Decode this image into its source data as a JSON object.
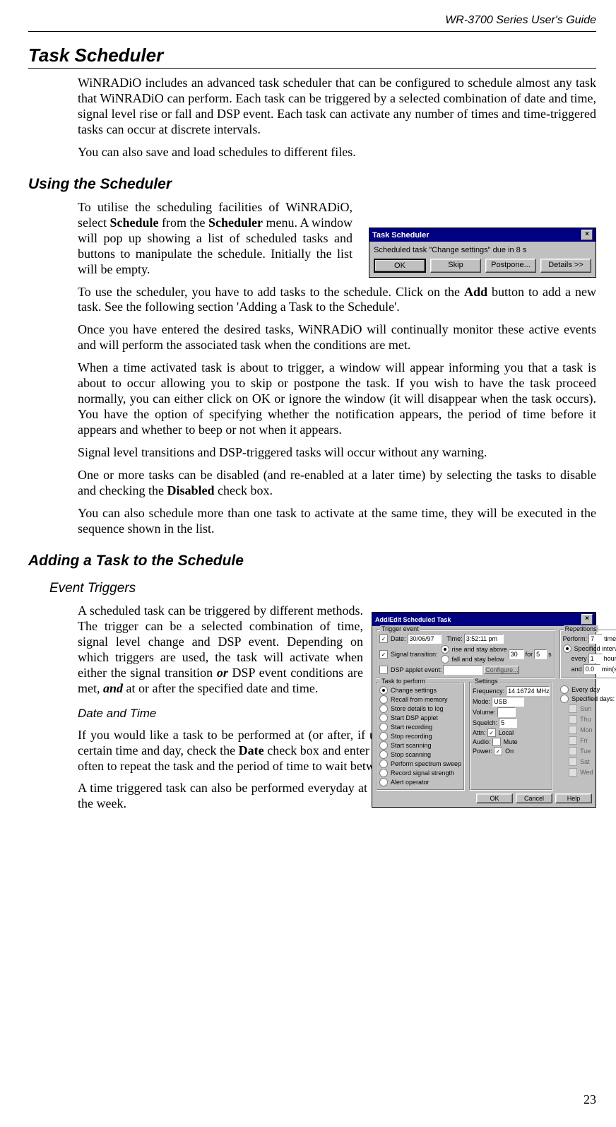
{
  "header": {
    "guide_title": "WR-3700 Series User's Guide"
  },
  "page_number": "23",
  "h1": "Task Scheduler",
  "p1": "WiNRADiO includes an advanced task scheduler that can be configured to schedule almost any task that WiNRADiO can perform. Each task can be triggered by a selected combination of date and time, signal level rise or fall and DSP event. Each task can activate any number of times and time-triggered tasks can occur at discrete intervals.",
  "p2": "You can also save and load schedules to different files.",
  "h2a": "Using the Scheduler",
  "p3_pre": "To utilise the scheduling facilities of WiNRADiO, select ",
  "p3_b1": "Schedule",
  "p3_mid": " from the ",
  "p3_b2": "Scheduler",
  "p3_post": " menu. A window will pop up showing a list of scheduled tasks and buttons to manipulate the schedule. Initially the list will be empty.",
  "p4_pre": "To use the scheduler, you have to add tasks to the schedule. Click on the ",
  "p4_b": "Add",
  "p4_post": " button to add a new task. See the following section 'Adding a Task to the Schedule'.",
  "p5": "Once you have entered the desired tasks, WiNRADiO will continually monitor these active events and will perform the associated task when the conditions are met.",
  "p6": "When a time activated task is about to trigger, a window will appear informing you that a task is about to occur allowing you to skip or postpone the task. If you wish to have the task proceed normally, you can either click on OK or ignore the window (it will disappear when the task occurs). You have the option of specifying whether the notification appears, the period of time before it appears and whether to beep or not when it appears.",
  "p7": "Signal level transitions and DSP-triggered tasks will occur without any warning.",
  "p8_pre": "One or more tasks can be disabled (and re-enabled at a later time) by selecting the tasks to disable and checking the ",
  "p8_b": "Disabled",
  "p8_post": " check box.",
  "p9": "You can also schedule more than one task to activate at the same time, they will be executed in the sequence shown in the list.",
  "h2b": "Adding a Task to the Schedule",
  "h3a": "Event Triggers",
  "p10_pre": "A scheduled task can be triggered by different methods. The trigger can be a selected combination of time, signal level change and DSP event. Depending on which triggers are used, the task will activate when either the signal transition ",
  "p10_i1": "or",
  "p10_mid": " DSP event conditions are met, ",
  "p10_i2": "and",
  "p10_post": " at or after the specified date and time.",
  "h4a": "Date and Time",
  "p11_pre": "If you would like a task to be performed at (or after, if using the signal transition or DSP events) a certain time and day, check the ",
  "p11_b": "Date",
  "p11_post": " check box and enter the date and time. You can also specify how often to repeat the task and the period of time to wait between each task in the 'Repetitions' section.",
  "p12": "A time triggered task can also be performed everyday at a certain time or on certain selected days of the week.",
  "dlg_small": {
    "title": "Task Scheduler",
    "msg": "Scheduled task \"Change settings\" due in 8 s",
    "ok": "OK",
    "skip": "Skip",
    "postpone": "Postpone...",
    "details": "Details >>"
  },
  "dlg_large": {
    "title": "Add/Edit Scheduled Task",
    "trigger_grp": "Trigger event",
    "date_lbl": "Date:",
    "date_val": "30/06/97",
    "time_lbl": "Time:",
    "time_val": "3:52:11 pm",
    "sig_lbl": "Signal transition:",
    "rise": "rise and stay above",
    "fall": "fall and stay below",
    "thresh": "30",
    "for_lbl": "for",
    "for_val": "5",
    "s_lbl": "s",
    "dsp_lbl": "DSP applet event:",
    "config": "Configure...",
    "task_grp": "Task to perform",
    "tasks": [
      "Change settings",
      "Recall from memory",
      "Store details to log",
      "Start DSP applet",
      "Start recording",
      "Stop recording",
      "Start scanning",
      "Stop scanning",
      "Perform spectrum sweep",
      "Record signal strength",
      "Alert operator"
    ],
    "settings_grp": "Settings",
    "freq_lbl": "Frequency:",
    "freq_val": "14.16724 MHz",
    "mode_lbl": "Mode:",
    "mode_val": "USB",
    "vol_lbl": "Volume:",
    "sq_lbl": "Squelch:",
    "sq_val": "5",
    "attn_lbl": "Attn:",
    "attn_local": "Local",
    "audio_lbl": "Audio:",
    "audio_mute": "Mute",
    "power_lbl": "Power:",
    "power_on": "On",
    "rep_grp": "Repetitions",
    "perform": "Perform:",
    "perform_val": "7",
    "times": "time(s)",
    "spec_int": "Specified intervals:",
    "every": "every",
    "every_val": "1",
    "hours": "hour(s)",
    "and": "and",
    "and_val": "0.0",
    "mins": "min(s).",
    "every_day": "Every day",
    "spec_days": "Specified days:",
    "days": [
      "Sun",
      "Thu",
      "Mon",
      "Fri",
      "Tue",
      "Sat",
      "Wed"
    ],
    "ok": "OK",
    "cancel": "Cancel",
    "help": "Help"
  }
}
